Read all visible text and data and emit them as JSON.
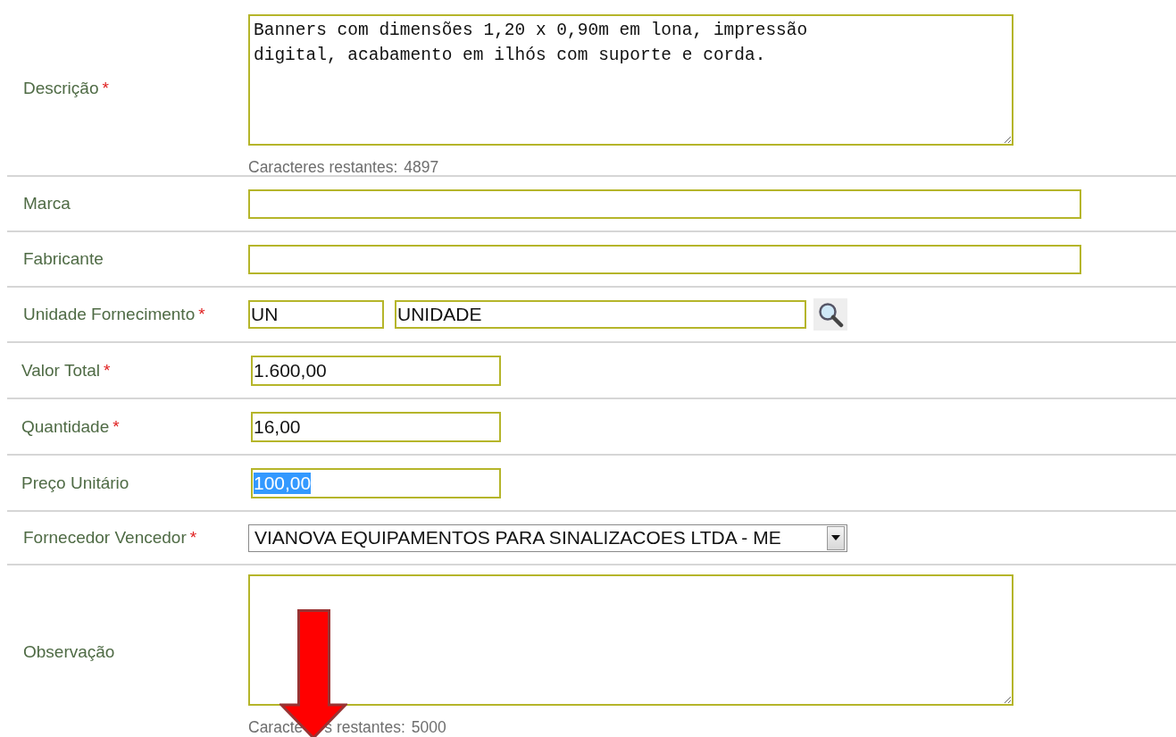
{
  "rows": [
    {
      "kind": "textarea",
      "label": "Descrição",
      "required_mark": "*",
      "value": "Banners com dimensões 1,20 x 0,90m em lona, impressão\ndigital, acabamento em ilhós com suporte e corda.",
      "counter": [
        "Caracteres restantes:",
        "4897"
      ]
    },
    {
      "kind": "text",
      "label": "Marca"
    },
    {
      "kind": "text",
      "label": "Fabricante"
    },
    {
      "kind": "unit",
      "label": "Unidade Fornecimento",
      "required_mark": "*",
      "code": "UN",
      "name": "UNIDADE"
    },
    {
      "kind": "number",
      "label": "Valor Total",
      "required_mark": "*",
      "value": "1.600,00",
      "highlighted": false
    },
    {
      "kind": "number",
      "label": "Quantidade",
      "required_mark": "*",
      "value": "16,00",
      "highlighted": false
    },
    {
      "kind": "number",
      "label": "Preço Unitário",
      "value": "100,00",
      "highlighted": true
    },
    {
      "kind": "select",
      "label": "Fornecedor Vencedor",
      "required_mark": "*",
      "value": "VIANOVA EQUIPAMENTOS PARA SINALIZACOES LTDA - ME"
    },
    {
      "kind": "textarea",
      "label": "Observação",
      "value": "",
      "counter": [
        "Caracte",
        "s restantes:",
        "5000"
      ],
      "arrow": true
    }
  ]
}
